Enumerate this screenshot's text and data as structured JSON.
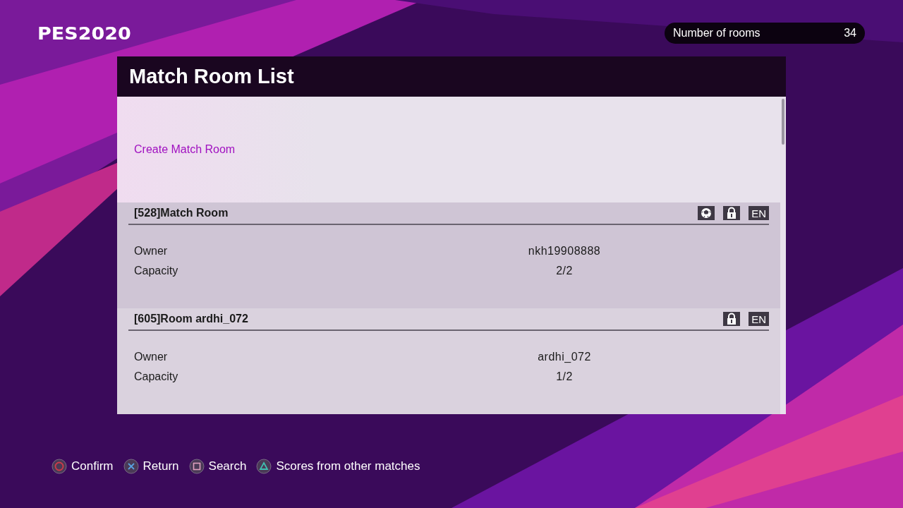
{
  "logo": "PES2020",
  "room_count": {
    "label": "Number of rooms",
    "value": "34"
  },
  "panel": {
    "title": "Match Room List",
    "create_label": "Create Match Room",
    "rooms": [
      {
        "name": "[528]Match Room",
        "badges": [
          {
            "kind": "ball"
          },
          {
            "kind": "lock"
          },
          {
            "kind": "language",
            "text": "EN"
          }
        ],
        "fields": [
          {
            "label": "Owner",
            "value": "nkh19908888"
          },
          {
            "label": "Capacity",
            "value": "2/2"
          }
        ]
      },
      {
        "name": "[605]Room ardhi_072",
        "badges": [
          {
            "kind": "lock"
          },
          {
            "kind": "language",
            "text": "EN"
          }
        ],
        "fields": [
          {
            "label": "Owner",
            "value": "ardhi_072"
          },
          {
            "label": "Capacity",
            "value": "1/2"
          }
        ]
      }
    ]
  },
  "hints": [
    {
      "kind": "circle",
      "label": "Confirm"
    },
    {
      "kind": "cross",
      "label": "Return"
    },
    {
      "kind": "square",
      "label": "Search"
    },
    {
      "kind": "triangle",
      "label": "Scores from other matches"
    }
  ]
}
